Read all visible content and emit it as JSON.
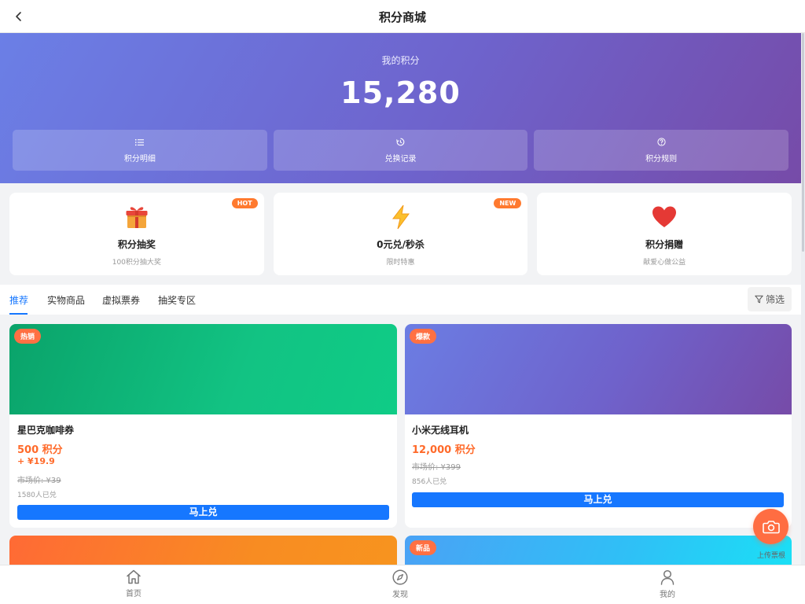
{
  "header": {
    "title": "积分商城",
    "back_icon": "chevron-left-icon"
  },
  "points_panel": {
    "label": "我的积分",
    "value": "15,280",
    "actions": [
      {
        "label": "积分明细",
        "icon": "list-icon"
      },
      {
        "label": "兑换记录",
        "icon": "history-icon"
      },
      {
        "label": "积分规则",
        "icon": "help-circle-icon"
      }
    ]
  },
  "features": [
    {
      "icon": "gift-icon",
      "title": "积分抽奖",
      "subtitle": "100积分抽大奖",
      "badge": "HOT",
      "badge_color": "#ff7a2f"
    },
    {
      "icon": "lightning-icon",
      "title": "0元兑/秒杀",
      "subtitle": "限时特惠",
      "badge": "NEW",
      "badge_color": "#ff7a2f"
    },
    {
      "icon": "heart-icon",
      "title": "积分捐赠",
      "subtitle": "献爱心做公益",
      "badge": "",
      "badge_color": ""
    }
  ],
  "tabs": [
    "推荐",
    "实物商品",
    "虚拟票券",
    "抽奖专区"
  ],
  "active_tab": "推荐",
  "filter": {
    "label": "筛选",
    "icon": "filter-icon"
  },
  "products": [
    {
      "tag": "热销",
      "name": "星巴克咖啡券",
      "points": "500 积分",
      "extra_price": "+ ¥19.9",
      "market_price": "市场价: ¥39",
      "sold": "1580人已兑",
      "button": "马上兑"
    },
    {
      "tag": "爆款",
      "name": "小米无线耳机",
      "points": "12,000 积分",
      "extra_price": "",
      "market_price": "市场价: ¥399",
      "sold": "856人已兑",
      "button": "马上兑"
    },
    {
      "tag": "",
      "name": "",
      "points": "",
      "extra_price": "",
      "market_price": "",
      "sold": "",
      "button": ""
    },
    {
      "tag": "新品",
      "name": "",
      "points": "",
      "extra_price": "",
      "market_price": "",
      "sold": "",
      "button": ""
    }
  ],
  "fab": {
    "label": "上传票根",
    "icon": "camera-icon"
  },
  "bottom_nav": [
    {
      "label": "首页",
      "icon": "home-icon"
    },
    {
      "label": "发现",
      "icon": "compass-icon"
    },
    {
      "label": "我的",
      "icon": "user-icon"
    }
  ],
  "colors": {
    "accent": "#1677ff",
    "price": "#ff6a2a",
    "tag": "#ff7043",
    "hero_gradient": [
      "#6b7fe6",
      "#764ba8"
    ],
    "fab": "#ff6d42"
  }
}
